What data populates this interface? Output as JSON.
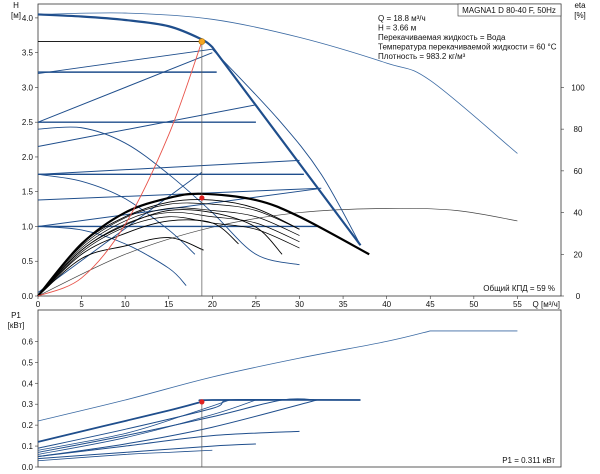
{
  "chart_data": {
    "type": "line",
    "title": "MAGNA1 D 80-40 F, 50Hz",
    "info": [
      "Q = 18.8 м³/ч",
      "H = 3.66 м",
      "Перекачиваемая жидкость = Вода",
      "Температура перекачиваемой жидкости = 60 °C",
      "Плотность = 983.2 кг/м³"
    ],
    "efficiency_label": "Общий КПД = 59 %",
    "power_label": "P1 = 0.311 кВт",
    "top_panel": {
      "ylabel": [
        "H",
        "[м]"
      ],
      "y2label": [
        "eta",
        "[%]"
      ],
      "xlabel": "Q [м³/ч]",
      "xlim": [
        0,
        60
      ],
      "ylim": [
        0,
        4.2
      ],
      "y2lim": [
        0,
        140
      ],
      "x_ticks": [
        "0",
        "5",
        "10",
        "15",
        "20",
        "25",
        "30",
        "35",
        "40",
        "45",
        "50",
        "55"
      ],
      "y_ticks": [
        "0.0",
        "0.5",
        "1.0",
        "1.5",
        "2.0",
        "2.5",
        "3.0",
        "3.5",
        "4.0"
      ],
      "y2_ticks": [
        "0",
        "20",
        "40",
        "60",
        "80",
        "100"
      ],
      "max_head_curve": [
        [
          0,
          4.05
        ],
        [
          5,
          4.02
        ],
        [
          10,
          3.97
        ],
        [
          15,
          3.88
        ],
        [
          18.8,
          3.69
        ],
        [
          20,
          3.58
        ],
        [
          37,
          0.73
        ]
      ],
      "proportional_pressure_curves": [
        [
          [
            0,
            2.5
          ],
          [
            20,
            3.5
          ]
        ],
        [
          [
            0,
            2.15
          ],
          [
            25,
            2.75
          ]
        ],
        [
          [
            0,
            1.75
          ],
          [
            30,
            1.95
          ]
        ],
        [
          [
            0,
            1.38
          ],
          [
            32.5,
            1.55
          ]
        ],
        [
          [
            0,
            1.0
          ],
          [
            32,
            1.54
          ]
        ]
      ],
      "constant_pressure_curves": [
        [
          [
            0,
            3.66
          ],
          [
            18.8,
            3.66
          ]
        ],
        [
          [
            0,
            3.22
          ],
          [
            20.5,
            3.22
          ]
        ],
        [
          [
            0,
            2.5
          ],
          [
            25,
            2.5
          ]
        ],
        [
          [
            0,
            1.75
          ],
          [
            30.5,
            1.75
          ]
        ],
        [
          [
            0,
            1.0
          ],
          [
            32,
            1.0
          ]
        ]
      ],
      "system_curve": [
        [
          0,
          0
        ],
        [
          5,
          0.26
        ],
        [
          10,
          1.03
        ],
        [
          15,
          2.32
        ],
        [
          18.8,
          3.66
        ]
      ],
      "duty_point": {
        "q": 18.8,
        "h": 3.66
      },
      "efficiency_curves": [
        [
          [
            0,
            0
          ],
          [
            5,
            25
          ],
          [
            10,
            40
          ],
          [
            15,
            47
          ],
          [
            18.8,
            49
          ],
          [
            25,
            46
          ],
          [
            30,
            38
          ],
          [
            38,
            20
          ]
        ],
        [
          [
            0,
            0
          ],
          [
            5,
            25
          ],
          [
            10,
            38
          ],
          [
            15,
            45
          ],
          [
            20,
            46
          ],
          [
            25,
            42
          ],
          [
            30,
            32
          ]
        ],
        [
          [
            0,
            0
          ],
          [
            5,
            22
          ],
          [
            10,
            34
          ],
          [
            15,
            41
          ],
          [
            20,
            40
          ],
          [
            25,
            33
          ],
          [
            28,
            20
          ]
        ],
        [
          [
            0,
            0
          ],
          [
            5,
            20
          ],
          [
            10,
            30
          ],
          [
            15,
            36
          ],
          [
            20,
            35
          ],
          [
            23,
            25
          ]
        ],
        [
          [
            0,
            0
          ],
          [
            5,
            18
          ],
          [
            10,
            24
          ],
          [
            15,
            28
          ],
          [
            19,
            22
          ]
        ]
      ],
      "efficiency_duty_point": {
        "q": 18.8,
        "eta": 59
      }
    },
    "bottom_panel": {
      "ylabel": [
        "P1",
        "[кВт]"
      ],
      "xlim": [
        0,
        60
      ],
      "ylim": [
        0,
        0.75
      ],
      "y_ticks": [
        "0.0",
        "0.1",
        "0.2",
        "0.3",
        "0.4",
        "0.5",
        "0.6"
      ],
      "max_power_curve": [
        [
          0,
          0.22
        ],
        [
          10,
          0.32
        ],
        [
          20,
          0.43
        ],
        [
          30,
          0.52
        ],
        [
          40,
          0.6
        ],
        [
          45,
          0.65
        ],
        [
          55,
          0.65
        ]
      ],
      "power_curves": [
        [
          [
            0,
            0.12
          ],
          [
            5,
            0.17
          ],
          [
            10,
            0.22
          ],
          [
            15,
            0.27
          ],
          [
            18.8,
            0.311
          ],
          [
            20,
            0.32
          ],
          [
            37,
            0.32
          ]
        ],
        [
          [
            0,
            0.09
          ],
          [
            10,
            0.18
          ],
          [
            20,
            0.28
          ],
          [
            22,
            0.32
          ],
          [
            30,
            0.32
          ]
        ],
        [
          [
            0,
            0.07
          ],
          [
            10,
            0.15
          ],
          [
            20,
            0.24
          ],
          [
            28,
            0.32
          ],
          [
            32,
            0.32
          ]
        ],
        [
          [
            0,
            0.05
          ],
          [
            10,
            0.11
          ],
          [
            20,
            0.19
          ],
          [
            32,
            0.32
          ]
        ],
        [
          [
            0,
            0.05
          ],
          [
            10,
            0.1
          ],
          [
            20,
            0.15
          ],
          [
            30,
            0.17
          ]
        ],
        [
          [
            0,
            0.04
          ],
          [
            10,
            0.07
          ],
          [
            20,
            0.1
          ],
          [
            25,
            0.11
          ]
        ]
      ],
      "duty_point": {
        "q": 18.8,
        "p": 0.311
      }
    }
  }
}
